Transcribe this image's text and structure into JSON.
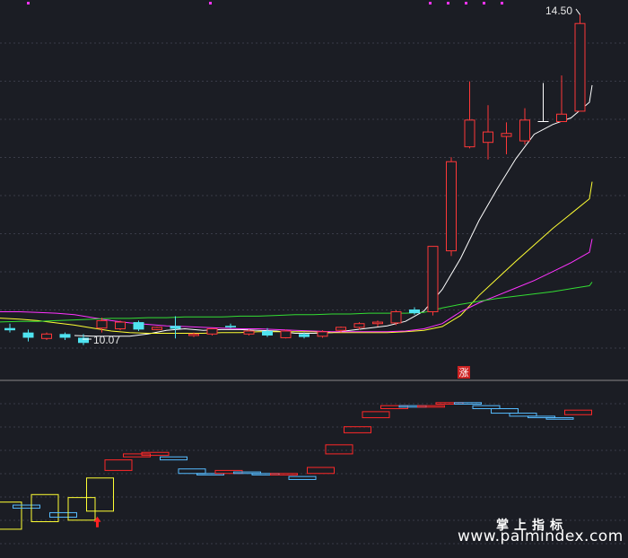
{
  "chart_data": {
    "type": "candlestick",
    "title": "",
    "price_ylim": [
      9.6,
      14.6
    ],
    "annotations": {
      "high_label": "14.50",
      "low_label": "10.07",
      "limit_up_badge": "涨"
    },
    "candles": [
      {
        "o": 10.28,
        "h": 10.34,
        "l": 10.22,
        "c": 10.25
      },
      {
        "o": 10.22,
        "h": 10.26,
        "l": 10.1,
        "c": 10.15
      },
      {
        "o": 10.14,
        "h": 10.22,
        "l": 10.12,
        "c": 10.2
      },
      {
        "o": 10.2,
        "h": 10.22,
        "l": 10.12,
        "c": 10.15
      },
      {
        "o": 10.15,
        "h": 10.2,
        "l": 10.05,
        "c": 10.08
      },
      {
        "o": 10.28,
        "h": 10.42,
        "l": 10.22,
        "c": 10.38
      },
      {
        "o": 10.27,
        "h": 10.38,
        "l": 10.25,
        "c": 10.36
      },
      {
        "o": 10.36,
        "h": 10.38,
        "l": 10.24,
        "c": 10.26
      },
      {
        "o": 10.26,
        "h": 10.3,
        "l": 10.25,
        "c": 10.29
      },
      {
        "o": 10.31,
        "h": 10.44,
        "l": 10.14,
        "c": 10.27
      },
      {
        "o": 10.18,
        "h": 10.22,
        "l": 10.16,
        "c": 10.2
      },
      {
        "o": 10.2,
        "h": 10.28,
        "l": 10.18,
        "c": 10.27
      },
      {
        "o": 10.31,
        "h": 10.34,
        "l": 10.28,
        "c": 10.29
      },
      {
        "o": 10.2,
        "h": 10.26,
        "l": 10.18,
        "c": 10.24
      },
      {
        "o": 10.24,
        "h": 10.28,
        "l": 10.16,
        "c": 10.18
      },
      {
        "o": 10.15,
        "h": 10.26,
        "l": 10.14,
        "c": 10.24
      },
      {
        "o": 10.2,
        "h": 10.22,
        "l": 10.14,
        "c": 10.16
      },
      {
        "o": 10.17,
        "h": 10.25,
        "l": 10.15,
        "c": 10.23
      },
      {
        "o": 10.25,
        "h": 10.3,
        "l": 10.22,
        "c": 10.29
      },
      {
        "o": 10.29,
        "h": 10.36,
        "l": 10.26,
        "c": 10.34
      },
      {
        "o": 10.34,
        "h": 10.38,
        "l": 10.3,
        "c": 10.36
      },
      {
        "o": 10.35,
        "h": 10.52,
        "l": 10.32,
        "c": 10.5
      },
      {
        "o": 10.53,
        "h": 10.56,
        "l": 10.46,
        "c": 10.48
      },
      {
        "o": 10.5,
        "h": 11.38,
        "l": 10.45,
        "c": 11.38
      },
      {
        "o": 11.32,
        "h": 12.58,
        "l": 11.25,
        "c": 12.52
      },
      {
        "o": 12.72,
        "h": 13.6,
        "l": 12.7,
        "c": 13.08
      },
      {
        "o": 12.78,
        "h": 13.28,
        "l": 12.55,
        "c": 12.92
      },
      {
        "o": 12.86,
        "h": 13.05,
        "l": 12.62,
        "c": 12.9
      },
      {
        "o": 12.8,
        "h": 13.24,
        "l": 12.75,
        "c": 13.08
      },
      {
        "o": 13.06,
        "h": 13.58,
        "l": 13.06,
        "c": 13.06
      },
      {
        "o": 13.06,
        "h": 13.68,
        "l": 13.06,
        "c": 13.16
      },
      {
        "o": 13.2,
        "h": 14.5,
        "l": 13.2,
        "c": 14.38
      }
    ],
    "ma_series": [
      {
        "color": "#ffffff",
        "values": [
          null,
          null,
          null,
          null,
          10.18,
          10.17,
          10.17,
          10.17,
          10.2,
          10.25,
          10.27,
          10.25,
          10.26,
          10.26,
          10.25,
          10.24,
          10.21,
          10.21,
          10.22,
          10.25,
          10.28,
          10.31,
          10.37,
          10.51,
          10.8,
          11.22,
          11.73,
          12.16,
          12.56,
          12.89,
          13.02,
          13.11,
          13.32,
          13.55
        ]
      },
      {
        "color": "#ffff33",
        "values": [
          10.42,
          10.4,
          10.38,
          10.35,
          10.32,
          10.28,
          10.24,
          10.22,
          10.21,
          10.21,
          10.21,
          10.21,
          10.22,
          10.22,
          10.23,
          10.23,
          10.23,
          10.23,
          10.22,
          10.22,
          10.22,
          10.22,
          10.23,
          10.25,
          10.3,
          10.45,
          10.72,
          10.95,
          11.18,
          11.4,
          11.62,
          11.82,
          12.02,
          12.25
        ]
      },
      {
        "color": "#ff33ff",
        "values": [
          10.5,
          10.5,
          10.49,
          10.48,
          10.46,
          10.42,
          10.38,
          10.35,
          10.33,
          10.31,
          10.3,
          10.29,
          10.28,
          10.27,
          10.27,
          10.26,
          10.25,
          10.24,
          10.23,
          10.23,
          10.23,
          10.23,
          10.24,
          10.27,
          10.34,
          10.5,
          10.62,
          10.72,
          10.82,
          10.92,
          11.04,
          11.16,
          11.3,
          11.48
        ]
      },
      {
        "color": "#33dd33",
        "values": [
          10.36,
          10.37,
          10.37,
          10.38,
          10.39,
          10.4,
          10.41,
          10.41,
          10.42,
          10.42,
          10.43,
          10.43,
          10.43,
          10.44,
          10.44,
          10.45,
          10.46,
          10.46,
          10.47,
          10.47,
          10.48,
          10.48,
          10.48,
          10.49,
          10.55,
          10.6,
          10.64,
          10.68,
          10.71,
          10.74,
          10.77,
          10.81,
          10.85,
          10.9
        ]
      }
    ],
    "indicator": {
      "type": "box-series",
      "ylim": [
        0,
        100
      ],
      "boxes": [
        {
          "c": "yellow",
          "lo": 6,
          "hi": 24
        },
        {
          "c": "blue",
          "lo": 20,
          "hi": 22
        },
        {
          "c": "yellow",
          "lo": 11,
          "hi": 29
        },
        {
          "c": "blue",
          "lo": 14,
          "hi": 17
        },
        {
          "c": "yellow",
          "lo": 12,
          "hi": 27
        },
        {
          "c": "yellow",
          "lo": 18,
          "hi": 40
        },
        {
          "c": "red",
          "lo": 45,
          "hi": 52
        },
        {
          "c": "red",
          "lo": 54,
          "hi": 56
        },
        {
          "c": "red",
          "lo": 55,
          "hi": 57
        },
        {
          "c": "blue",
          "lo": 52,
          "hi": 54
        },
        {
          "c": "blue",
          "lo": 43,
          "hi": 46
        },
        {
          "c": "blue",
          "lo": 42,
          "hi": 43
        },
        {
          "c": "red",
          "lo": 43,
          "hi": 45
        },
        {
          "c": "blue",
          "lo": 43,
          "hi": 44
        },
        {
          "c": "blue",
          "lo": 42,
          "hi": 43
        },
        {
          "c": "red",
          "lo": 42,
          "hi": 43
        },
        {
          "c": "blue",
          "lo": 39,
          "hi": 41
        },
        {
          "c": "red",
          "lo": 43,
          "hi": 47
        },
        {
          "c": "red",
          "lo": 56,
          "hi": 62
        },
        {
          "c": "red",
          "lo": 70,
          "hi": 74
        },
        {
          "c": "red",
          "lo": 80,
          "hi": 84
        },
        {
          "c": "red",
          "lo": 86,
          "hi": 88
        },
        {
          "c": "blue",
          "lo": 87,
          "hi": 88
        },
        {
          "c": "red",
          "lo": 87,
          "hi": 88
        },
        {
          "c": "red",
          "lo": 89,
          "hi": 90
        },
        {
          "c": "blue",
          "lo": 89,
          "hi": 90
        },
        {
          "c": "blue",
          "lo": 86,
          "hi": 88
        },
        {
          "c": "blue",
          "lo": 83,
          "hi": 86
        },
        {
          "c": "blue",
          "lo": 81,
          "hi": 83
        },
        {
          "c": "blue",
          "lo": 80,
          "hi": 81
        },
        {
          "c": "blue",
          "lo": 79,
          "hi": 80
        },
        {
          "c": "red",
          "lo": 82,
          "hi": 85
        }
      ],
      "buy_signal_index": 5
    },
    "colors": {
      "up": "#ff3838",
      "down": "#4fe3f0",
      "doji": "#ffffff",
      "box_yellow": "#ffff33",
      "box_red": "#ff2828",
      "box_blue": "#55bbff",
      "grid": "#3a3c48",
      "divider": "#888888",
      "arrow": "#ff2222",
      "badge_bg": "#cc2222",
      "dots": "#ff33ff"
    }
  },
  "watermark": {
    "brand": "掌上指标",
    "url": "www.palmindex.com"
  }
}
